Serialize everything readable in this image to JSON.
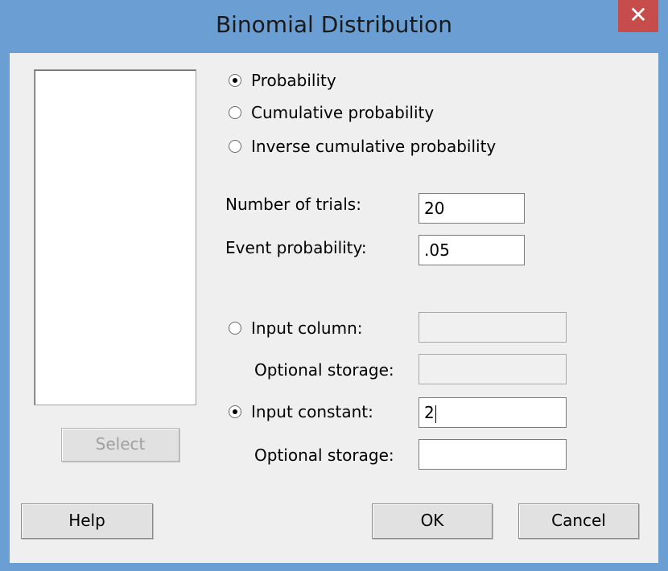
{
  "window": {
    "title": "Binomial Distribution",
    "close_glyph": "✕"
  },
  "dialog": {
    "select_button": "Select",
    "help_button": "Help",
    "ok_button": "OK",
    "cancel_button": "Cancel",
    "mode_options": [
      {
        "label": "Probability",
        "selected": true
      },
      {
        "label": "Cumulative probability",
        "selected": false
      },
      {
        "label": "Inverse cumulative probability",
        "selected": false
      }
    ],
    "trials": {
      "label": "Number of trials:",
      "value": "20"
    },
    "event_probability": {
      "label": "Event probability:",
      "value": ".05"
    },
    "input_column": {
      "label": "Input column:",
      "selected": false,
      "value": ""
    },
    "input_column_storage": {
      "label": "Optional storage:",
      "value": ""
    },
    "input_constant": {
      "label": "Input constant:",
      "selected": true,
      "value": "2"
    },
    "input_constant_storage": {
      "label": "Optional storage:",
      "value": ""
    }
  }
}
